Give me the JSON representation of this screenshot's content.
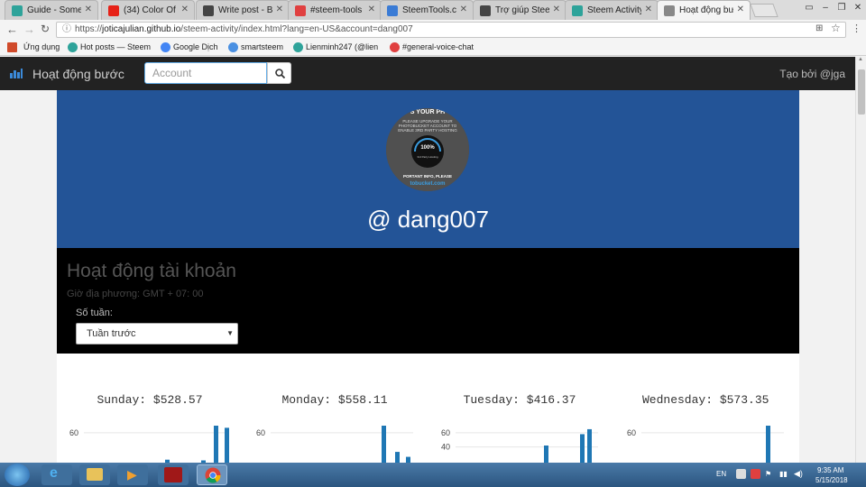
{
  "browser": {
    "tabs": [
      {
        "title": "Guide - Some ap",
        "color": "#2ea39a"
      },
      {
        "title": "(34) Color Of",
        "color": "#e62117"
      },
      {
        "title": "Write post - Bus",
        "color": "#444444"
      },
      {
        "title": "#steem-tools",
        "color": "#e04040"
      },
      {
        "title": "SteemTools.com",
        "color": "#3a7bd5"
      },
      {
        "title": "Trợ giúp Steem",
        "color": "#444444"
      },
      {
        "title": "Steem Activity -",
        "color": "#2ea39a"
      },
      {
        "title": "Hoạt động bước",
        "color": "#888888"
      }
    ],
    "url_prefix": "https://",
    "url_host": "joticajulian.github.io",
    "url_rest": "/steem-activity/index.html?lang=en-US&account=dang007",
    "bookmarks": [
      {
        "label": "Ứng dụng",
        "color": "#d04a2a"
      },
      {
        "label": "Hot posts — Steem",
        "color": "#2ea39a"
      },
      {
        "label": "Google Dịch",
        "color": "#4285f4"
      },
      {
        "label": "smartsteem",
        "color": "#4a90e2"
      },
      {
        "label": "Lienminh247 (@lien",
        "color": "#2ea39a"
      },
      {
        "label": "#general-voice-chat",
        "color": "#e04040"
      }
    ]
  },
  "navbar": {
    "brand": "Hoạt động bước",
    "search_placeholder": "Account",
    "credit": "Tạo bởi @jga"
  },
  "hero": {
    "username": "@ dang007",
    "avatar_lines": [
      "S YOUR PH",
      "PLEASE UPGRADE YOUR",
      "PHOTOBUCKET ACCOUNT TO",
      "ENABLE 3RD PARTY HOSTING",
      "100%",
      "3rd Party Hosting",
      "PORTANT INFO, PLEASE",
      "tobucket.com"
    ]
  },
  "panel": {
    "title": "Hoạt động tài khoản",
    "timezone": "Giờ địa phương: GMT + 07: 00",
    "weeks_label": "Số tuần:",
    "select_value": "Tuần trước"
  },
  "charts": [
    {
      "title": "Sunday: $528.57",
      "ticks": [
        "60"
      ],
      "tick_values": [
        60
      ],
      "ymax": 70,
      "values": [
        5,
        22,
        4,
        21,
        70,
        67
      ]
    },
    {
      "title": "Monday: $558.11",
      "ticks": [
        "60"
      ],
      "tick_values": [
        60
      ],
      "ymax": 70,
      "values": [
        70,
        33,
        26
      ]
    },
    {
      "title": "Tuesday: $416.37",
      "ticks": [
        "60",
        "40"
      ],
      "tick_values": [
        60,
        40
      ],
      "ymax": 70,
      "values": [
        42,
        58,
        65
      ]
    },
    {
      "title": "Wednesday: $573.35",
      "ticks": [
        "60"
      ],
      "tick_values": [
        60
      ],
      "ymax": 70,
      "values": [
        70
      ]
    }
  ],
  "taskbar": {
    "lang": "EN",
    "time": "9:35 AM",
    "date": "5/15/2018"
  }
}
